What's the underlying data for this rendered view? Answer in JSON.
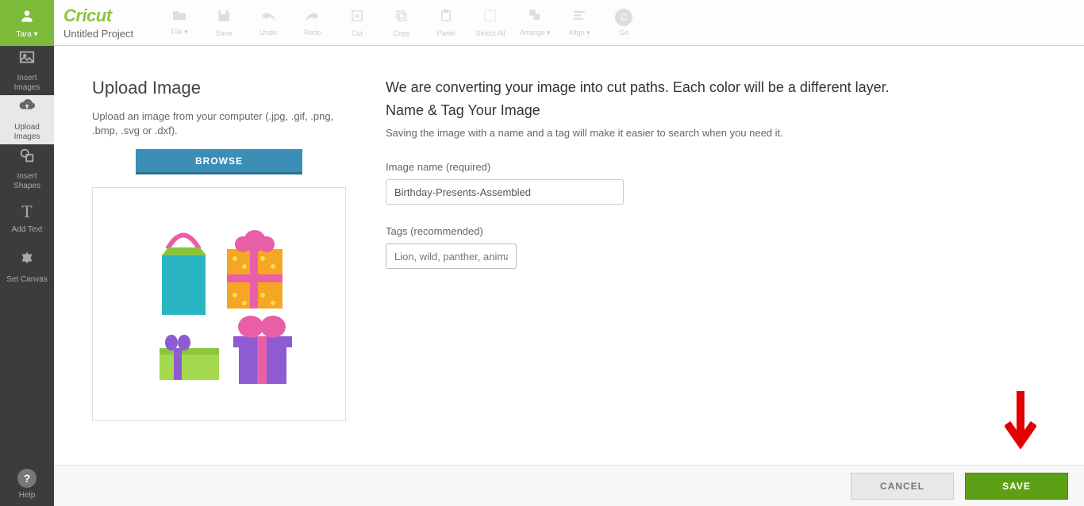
{
  "user": {
    "name": "Tara ▾"
  },
  "sidebar": {
    "items": [
      {
        "label": "Insert\nImages"
      },
      {
        "label": "Upload\nImages"
      },
      {
        "label": "Insert\nShapes"
      },
      {
        "label": "Add Text"
      },
      {
        "label": "Set Canvas"
      }
    ],
    "help": "Help"
  },
  "topbar": {
    "brand": "Cricut",
    "project": "Untitled Project",
    "items": [
      "File ▾",
      "Save",
      "Undo",
      "Redo",
      "Cut",
      "Copy",
      "Paste",
      "Select All",
      "Arrange ▾",
      "Align ▾",
      "Go"
    ]
  },
  "upload": {
    "heading": "Upload Image",
    "desc": "Upload an image from your computer (.jpg, .gif, .png, .bmp, .svg or .dxf).",
    "browse": "BROWSE"
  },
  "convert": {
    "line1": "We are converting your image into cut paths. Each color will be a different layer.",
    "line2": "Name & Tag Your Image",
    "line3": "Saving the image with a name and a tag will make it easier to search when you need it.",
    "name_label": "Image name (required)",
    "name_value": "Birthday-Presents-Assembled",
    "tags_label": "Tags (recommended)",
    "tags_placeholder": "Lion, wild, panther, anima"
  },
  "footer": {
    "cancel": "CANCEL",
    "save": "SAVE"
  }
}
